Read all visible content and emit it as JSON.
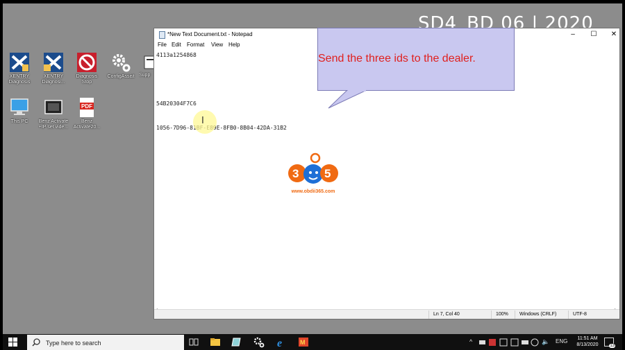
{
  "background_watermark": "SD4_BD 06 | 2020",
  "desktop_icons": [
    {
      "label": "XENTRY Diagnosis",
      "icon": "xentry-diagnosis-icon"
    },
    {
      "label": "XENTRY Diagnosi...",
      "icon": "xentry-diagnosis-icon"
    },
    {
      "label": "Diagnosis Stop",
      "icon": "diagnosis-stop-icon"
    },
    {
      "label": "ConfigAssist",
      "icon": "config-assist-icon"
    },
    {
      "label": "Supp",
      "icon": "support-icon"
    },
    {
      "label": "This PC",
      "icon": "this-pc-icon"
    },
    {
      "label": "Benz Activate +IP set vide...",
      "icon": "video-file-icon"
    },
    {
      "label": "Benz Activate20...",
      "icon": "pdf-file-icon"
    }
  ],
  "notepad": {
    "title": "*New Text Document.txt - Notepad",
    "controls": {
      "minimize": "–",
      "maximize": "☐",
      "close": "✕"
    },
    "menu": [
      "File",
      "Edit",
      "Format",
      "View",
      "Help"
    ],
    "lines": [
      "4113a1254868",
      "",
      "54B20304F7C6",
      "",
      "1056-7D96-81BF-E89E-8FB0-8B04-42DA-31B2"
    ],
    "status": {
      "position": "Ln 7, Col 40",
      "zoom": "100%",
      "line_ending": "Windows (CRLF)",
      "encoding": "UTF-8"
    }
  },
  "callout": {
    "text": "Send the three ids to the dealer.",
    "color": "#e0201e"
  },
  "logo": {
    "number": "365",
    "url": "www.obdii365.com",
    "color": "#f06a12"
  },
  "taskbar": {
    "search_placeholder": "Type here to search",
    "apps": [
      "task-view-icon",
      "file-explorer-icon",
      "app-icon",
      "config-assist-icon",
      "edge-icon",
      "media-app-icon"
    ],
    "tray_language": "ENG",
    "time": "11:51 AM",
    "date": "8/13/2020",
    "notification_count": "13"
  }
}
